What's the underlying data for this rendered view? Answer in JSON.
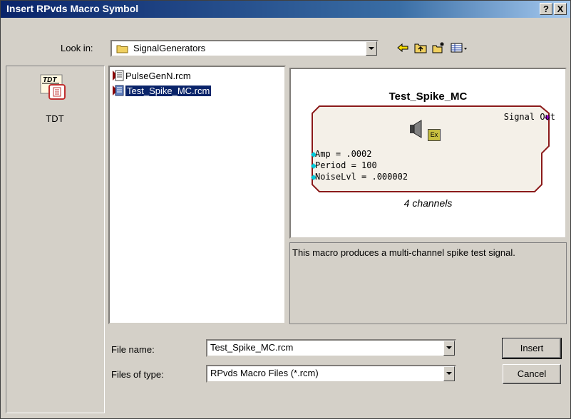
{
  "dialog": {
    "title": "Insert RPvds Macro Symbol",
    "help_label": "?",
    "close_label": "X"
  },
  "look_in": {
    "label": "Look in:",
    "value": "SignalGenerators"
  },
  "places": [
    {
      "label": "TDT",
      "icon": "tdt-icon"
    }
  ],
  "files": [
    {
      "name": "PulseGenN.rcm",
      "selected": false
    },
    {
      "name": "Test_Spike_MC.rcm",
      "selected": true
    }
  ],
  "preview": {
    "title": "Test_Spike_MC",
    "output_label": "Signal Out",
    "params": [
      "Amp = .0002",
      "Period = 100",
      "NoiseLvl = .000002"
    ],
    "channels": "4 channels",
    "ex_badge": "Ex",
    "description": "This macro produces a multi-channel spike test signal."
  },
  "file_name": {
    "label": "File name:",
    "value": "Test_Spike_MC.rcm"
  },
  "file_type": {
    "label": "Files of type:",
    "value": "RPvds Macro Files (*.rcm)"
  },
  "buttons": {
    "insert": "Insert",
    "cancel": "Cancel"
  },
  "colors": {
    "title_gradient_start": "#0a246a",
    "selection": "#0a246a",
    "macro_border": "#8b1a1a",
    "macro_fill": "#f4f0e8",
    "input_port": "#00c8d8",
    "output_port": "#9900cc"
  }
}
